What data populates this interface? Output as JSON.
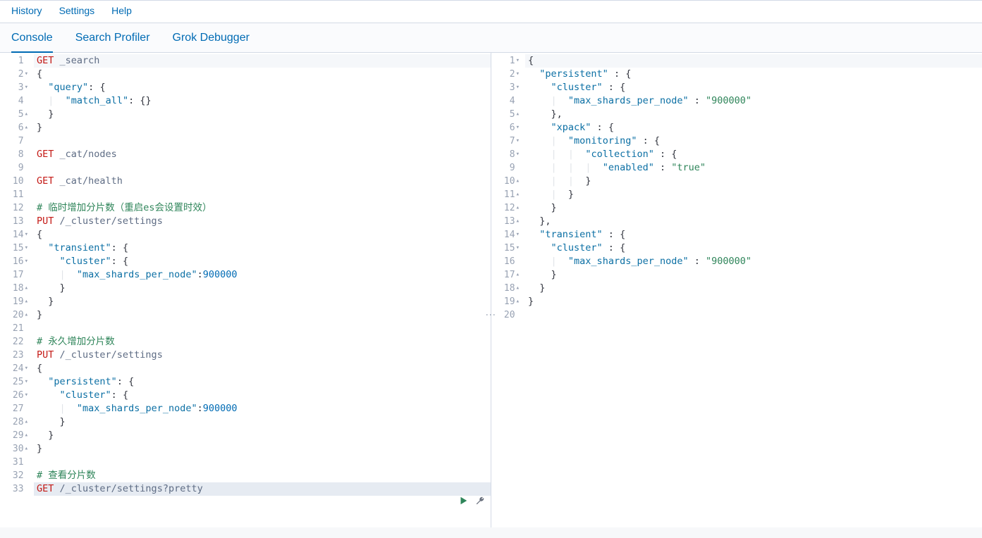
{
  "menu": {
    "history": "History",
    "settings": "Settings",
    "help": "Help"
  },
  "tabs": {
    "console": "Console",
    "profiler": "Search Profiler",
    "grok": "Grok Debugger"
  },
  "request_editor": {
    "lines": [
      {
        "n": 1,
        "arrow": "",
        "parts": [
          [
            "method-get",
            "GET"
          ],
          [
            "",
            ""
          ],
          [
            "path",
            " _search"
          ]
        ]
      },
      {
        "n": 2,
        "arrow": "▾",
        "parts": [
          [
            "brace",
            "{"
          ]
        ]
      },
      {
        "n": 3,
        "arrow": "▾",
        "parts": [
          [
            "",
            "  "
          ],
          [
            "key",
            "\"query\""
          ],
          [
            "colon",
            ": "
          ],
          [
            "brace",
            "{"
          ]
        ]
      },
      {
        "n": 4,
        "arrow": "",
        "parts": [
          [
            "",
            "  "
          ],
          [
            "indent-guide",
            "|"
          ],
          [
            "",
            "  "
          ],
          [
            "key",
            "\"match_all\""
          ],
          [
            "colon",
            ": "
          ],
          [
            "brace",
            "{}"
          ]
        ]
      },
      {
        "n": 5,
        "arrow": "▴",
        "parts": [
          [
            "",
            "  "
          ],
          [
            "brace",
            "}"
          ]
        ]
      },
      {
        "n": 6,
        "arrow": "▴",
        "parts": [
          [
            "brace",
            "}"
          ]
        ]
      },
      {
        "n": 7,
        "arrow": "",
        "parts": []
      },
      {
        "n": 8,
        "arrow": "",
        "parts": [
          [
            "method-get",
            "GET"
          ],
          [
            "path",
            " _cat/nodes"
          ]
        ]
      },
      {
        "n": 9,
        "arrow": "",
        "parts": []
      },
      {
        "n": 10,
        "arrow": "",
        "parts": [
          [
            "method-get",
            "GET"
          ],
          [
            "path",
            " _cat/health"
          ]
        ]
      },
      {
        "n": 11,
        "arrow": "",
        "parts": []
      },
      {
        "n": 12,
        "arrow": "",
        "parts": [
          [
            "comment",
            "# 临时增加分片数（重启es会设置时效）"
          ]
        ]
      },
      {
        "n": 13,
        "arrow": "",
        "parts": [
          [
            "method-put",
            "PUT"
          ],
          [
            "path",
            " /_cluster/settings"
          ]
        ]
      },
      {
        "n": 14,
        "arrow": "▾",
        "parts": [
          [
            "brace",
            "{"
          ]
        ]
      },
      {
        "n": 15,
        "arrow": "▾",
        "parts": [
          [
            "",
            "  "
          ],
          [
            "key",
            "\"transient\""
          ],
          [
            "colon",
            ": "
          ],
          [
            "brace",
            "{"
          ]
        ]
      },
      {
        "n": 16,
        "arrow": "▾",
        "parts": [
          [
            "",
            "    "
          ],
          [
            "key",
            "\"cluster\""
          ],
          [
            "colon",
            ": "
          ],
          [
            "brace",
            "{"
          ]
        ]
      },
      {
        "n": 17,
        "arrow": "",
        "parts": [
          [
            "",
            "    "
          ],
          [
            "indent-guide",
            "|"
          ],
          [
            "",
            "  "
          ],
          [
            "key",
            "\"max_shards_per_node\""
          ],
          [
            "colon",
            ":"
          ],
          [
            "num",
            "900000"
          ]
        ]
      },
      {
        "n": 18,
        "arrow": "▴",
        "parts": [
          [
            "",
            "    "
          ],
          [
            "brace",
            "}"
          ]
        ]
      },
      {
        "n": 19,
        "arrow": "▴",
        "parts": [
          [
            "",
            "  "
          ],
          [
            "brace",
            "}"
          ]
        ]
      },
      {
        "n": 20,
        "arrow": "▴",
        "parts": [
          [
            "brace",
            "}"
          ]
        ]
      },
      {
        "n": 21,
        "arrow": "",
        "parts": []
      },
      {
        "n": 22,
        "arrow": "",
        "parts": [
          [
            "comment",
            "# 永久增加分片数"
          ]
        ]
      },
      {
        "n": 23,
        "arrow": "",
        "parts": [
          [
            "method-put",
            "PUT"
          ],
          [
            "path",
            " /_cluster/settings"
          ]
        ]
      },
      {
        "n": 24,
        "arrow": "▾",
        "parts": [
          [
            "brace",
            "{"
          ]
        ]
      },
      {
        "n": 25,
        "arrow": "▾",
        "parts": [
          [
            "",
            "  "
          ],
          [
            "key",
            "\"persistent\""
          ],
          [
            "colon",
            ": "
          ],
          [
            "brace",
            "{"
          ]
        ]
      },
      {
        "n": 26,
        "arrow": "▾",
        "parts": [
          [
            "",
            "    "
          ],
          [
            "key",
            "\"cluster\""
          ],
          [
            "colon",
            ": "
          ],
          [
            "brace",
            "{"
          ]
        ]
      },
      {
        "n": 27,
        "arrow": "",
        "parts": [
          [
            "",
            "    "
          ],
          [
            "indent-guide",
            "|"
          ],
          [
            "",
            "  "
          ],
          [
            "key",
            "\"max_shards_per_node\""
          ],
          [
            "colon",
            ":"
          ],
          [
            "num",
            "900000"
          ]
        ]
      },
      {
        "n": 28,
        "arrow": "▴",
        "parts": [
          [
            "",
            "    "
          ],
          [
            "brace",
            "}"
          ]
        ]
      },
      {
        "n": 29,
        "arrow": "▴",
        "parts": [
          [
            "",
            "  "
          ],
          [
            "brace",
            "}"
          ]
        ]
      },
      {
        "n": 30,
        "arrow": "▴",
        "parts": [
          [
            "brace",
            "}"
          ]
        ]
      },
      {
        "n": 31,
        "arrow": "",
        "parts": []
      },
      {
        "n": 32,
        "arrow": "",
        "parts": [
          [
            "comment",
            "# 查看分片数"
          ]
        ]
      },
      {
        "n": 33,
        "arrow": "",
        "parts": [
          [
            "method-get",
            "GET"
          ],
          [
            "path",
            " /_cluster/settings?pretty"
          ]
        ],
        "highlight": true,
        "actions": true
      }
    ]
  },
  "response_viewer": {
    "lines": [
      {
        "n": 1,
        "arrow": "▾",
        "parts": [
          [
            "brace",
            "{"
          ]
        ],
        "bg": true
      },
      {
        "n": 2,
        "arrow": "▾",
        "parts": [
          [
            "",
            "  "
          ],
          [
            "str-key",
            "\"persistent\""
          ],
          [
            "colon",
            " : "
          ],
          [
            "brace",
            "{"
          ]
        ]
      },
      {
        "n": 3,
        "arrow": "▾",
        "parts": [
          [
            "",
            "    "
          ],
          [
            "str-key",
            "\"cluster\""
          ],
          [
            "colon",
            " : "
          ],
          [
            "brace",
            "{"
          ]
        ]
      },
      {
        "n": 4,
        "arrow": "",
        "parts": [
          [
            "",
            "    "
          ],
          [
            "indent-guide",
            "|"
          ],
          [
            "",
            "  "
          ],
          [
            "str-key",
            "\"max_shards_per_node\""
          ],
          [
            "colon",
            " : "
          ],
          [
            "str-val",
            "\"900000\""
          ]
        ]
      },
      {
        "n": 5,
        "arrow": "▴",
        "parts": [
          [
            "",
            "    "
          ],
          [
            "brace",
            "}"
          ],
          [
            "colon",
            ","
          ]
        ]
      },
      {
        "n": 6,
        "arrow": "▾",
        "parts": [
          [
            "",
            "    "
          ],
          [
            "str-key",
            "\"xpack\""
          ],
          [
            "colon",
            " : "
          ],
          [
            "brace",
            "{"
          ]
        ]
      },
      {
        "n": 7,
        "arrow": "▾",
        "parts": [
          [
            "",
            "    "
          ],
          [
            "indent-guide",
            "|"
          ],
          [
            "",
            "  "
          ],
          [
            "str-key",
            "\"monitoring\""
          ],
          [
            "colon",
            " : "
          ],
          [
            "brace",
            "{"
          ]
        ]
      },
      {
        "n": 8,
        "arrow": "▾",
        "parts": [
          [
            "",
            "    "
          ],
          [
            "indent-guide",
            "|"
          ],
          [
            "",
            "  "
          ],
          [
            "indent-guide",
            "|"
          ],
          [
            "",
            "  "
          ],
          [
            "str-key",
            "\"collection\""
          ],
          [
            "colon",
            " : "
          ],
          [
            "brace",
            "{"
          ]
        ]
      },
      {
        "n": 9,
        "arrow": "",
        "parts": [
          [
            "",
            "    "
          ],
          [
            "indent-guide",
            "|"
          ],
          [
            "",
            "  "
          ],
          [
            "indent-guide",
            "|"
          ],
          [
            "",
            "  "
          ],
          [
            "indent-guide",
            "|"
          ],
          [
            "",
            "  "
          ],
          [
            "str-key",
            "\"enabled\""
          ],
          [
            "colon",
            " : "
          ],
          [
            "str-val",
            "\"true\""
          ]
        ]
      },
      {
        "n": 10,
        "arrow": "▴",
        "parts": [
          [
            "",
            "    "
          ],
          [
            "indent-guide",
            "|"
          ],
          [
            "",
            "  "
          ],
          [
            "indent-guide",
            "|"
          ],
          [
            "",
            "  "
          ],
          [
            "brace",
            "}"
          ]
        ]
      },
      {
        "n": 11,
        "arrow": "▴",
        "parts": [
          [
            "",
            "    "
          ],
          [
            "indent-guide",
            "|"
          ],
          [
            "",
            "  "
          ],
          [
            "brace",
            "}"
          ]
        ]
      },
      {
        "n": 12,
        "arrow": "▴",
        "parts": [
          [
            "",
            "    "
          ],
          [
            "brace",
            "}"
          ]
        ]
      },
      {
        "n": 13,
        "arrow": "▴",
        "parts": [
          [
            "",
            "  "
          ],
          [
            "brace",
            "}"
          ],
          [
            "colon",
            ","
          ]
        ]
      },
      {
        "n": 14,
        "arrow": "▾",
        "parts": [
          [
            "",
            "  "
          ],
          [
            "str-key",
            "\"transient\""
          ],
          [
            "colon",
            " : "
          ],
          [
            "brace",
            "{"
          ]
        ]
      },
      {
        "n": 15,
        "arrow": "▾",
        "parts": [
          [
            "",
            "    "
          ],
          [
            "str-key",
            "\"cluster\""
          ],
          [
            "colon",
            " : "
          ],
          [
            "brace",
            "{"
          ]
        ]
      },
      {
        "n": 16,
        "arrow": "",
        "parts": [
          [
            "",
            "    "
          ],
          [
            "indent-guide",
            "|"
          ],
          [
            "",
            "  "
          ],
          [
            "str-key",
            "\"max_shards_per_node\""
          ],
          [
            "colon",
            " : "
          ],
          [
            "str-val",
            "\"900000\""
          ]
        ]
      },
      {
        "n": 17,
        "arrow": "▴",
        "parts": [
          [
            "",
            "    "
          ],
          [
            "brace",
            "}"
          ]
        ]
      },
      {
        "n": 18,
        "arrow": "▴",
        "parts": [
          [
            "",
            "  "
          ],
          [
            "brace",
            "}"
          ]
        ]
      },
      {
        "n": 19,
        "arrow": "▴",
        "parts": [
          [
            "brace",
            "}"
          ]
        ]
      },
      {
        "n": 20,
        "arrow": "",
        "parts": []
      }
    ]
  }
}
